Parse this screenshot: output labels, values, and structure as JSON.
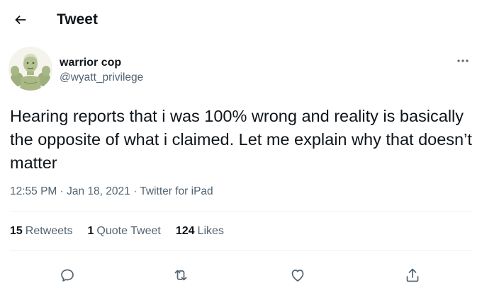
{
  "header": {
    "title": "Tweet",
    "back_icon": "arrow-left-icon"
  },
  "author": {
    "display_name": "warrior cop",
    "handle": "@wyatt_privilege",
    "more_icon": "more-horizontal-icon"
  },
  "tweet": {
    "text": "Hearing reports that i was 100% wrong and reality is basically the opposite of what i claimed. Let me explain why that doesn’t matter",
    "time": "12:55 PM",
    "date": "Jan 18, 2021",
    "source": "Twitter for iPad",
    "separator": "·"
  },
  "stats": {
    "retweets_count": "15",
    "retweets_label": "Retweets",
    "quotes_count": "1",
    "quotes_label": "Quote Tweet",
    "likes_count": "124",
    "likes_label": "Likes"
  },
  "actions": [
    "reply-icon",
    "retweet-icon",
    "like-icon",
    "share-icon"
  ],
  "colors": {
    "text": "#0f1419",
    "secondary": "#536471",
    "divider": "#eff3f4"
  }
}
